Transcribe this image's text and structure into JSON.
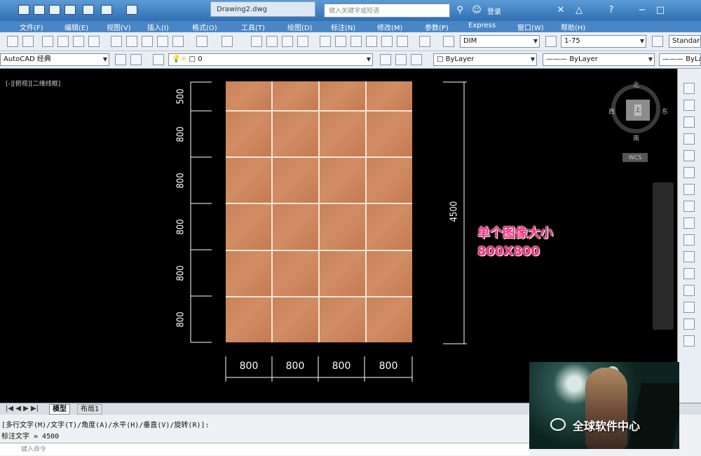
{
  "titlebar": {
    "filename": "Drawing2.dwg",
    "search_placeholder": "键入关键字或短语",
    "login": "登录"
  },
  "menu": [
    "文件(F)",
    "编辑(E)",
    "视图(V)",
    "插入(I)",
    "格式(O)",
    "工具(T)",
    "绘图(D)",
    "标注(N)",
    "修改(M)",
    "参数(P)",
    "Express",
    "窗口(W)",
    "帮助(H)"
  ],
  "toolbar": {
    "dim_style": "DIM",
    "scale": "1-75",
    "text_style": "Standard",
    "workspace": "AutoCAD 经典",
    "layer": "0",
    "color": "ByLayer",
    "linetype": "ByLayer",
    "lineweight": "ByLayer"
  },
  "viewport": {
    "label": "[-][俯视][二维线框]"
  },
  "drawing": {
    "vertical_dims": [
      "500",
      "800",
      "800",
      "800",
      "800",
      "800"
    ],
    "horizontal_dims": [
      "800",
      "800",
      "800",
      "800"
    ],
    "total_dim": "4500",
    "annotation_line1": "单个图像大小",
    "annotation_line2": "800X800"
  },
  "compass": {
    "north": "北",
    "south": "南",
    "east": "东",
    "west": "西",
    "center": "上",
    "wcs": "WCS"
  },
  "tabs": [
    "模型",
    "布局1"
  ],
  "command": {
    "line1": "[多行文字(M)/文字(T)/角度(A)/水平(H)/垂直(V)/旋转(R)]:",
    "line2": "标注文字 = 4500",
    "prompt": "键入命令"
  },
  "overlay": {
    "text": "全球软件中心"
  }
}
